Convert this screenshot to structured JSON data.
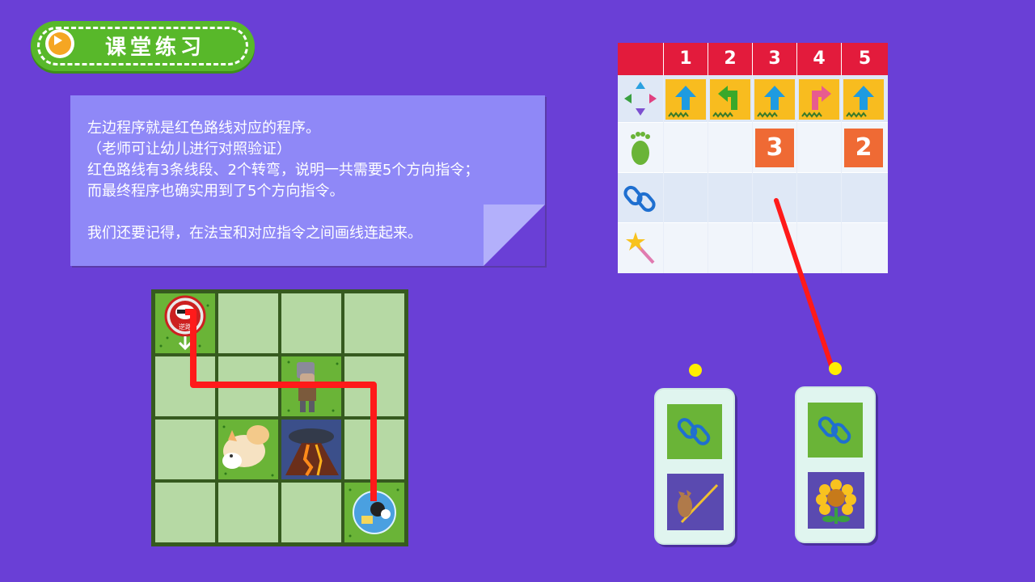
{
  "title": {
    "text": "课堂练习"
  },
  "note": {
    "lines": [
      "左边程序就是红色路线对应的程序。",
      "（老师可让幼儿进行对照验证）",
      "红色路线有3条线段、2个转弯，说明一共需要5个方向指令；",
      "而最终程序也确实用到了5个方向指令。",
      "",
      "我们还要记得，在法宝和对应指令之间画线连起来。"
    ]
  },
  "board": {
    "start_label": "逆路",
    "start_arrow": "down"
  },
  "table": {
    "columns": [
      "1",
      "2",
      "3",
      "4",
      "5"
    ],
    "row_icons": [
      "direction-arrows-icon",
      "footprint-icon",
      "chain-link-icon",
      "magic-wand-icon"
    ],
    "directions": [
      "up",
      "left-turn",
      "up",
      "right-turn",
      "up"
    ],
    "steps": [
      "",
      "",
      "3",
      "",
      "2"
    ],
    "colors": {
      "header": "#e31b3c",
      "tile": "#f8bc1f",
      "badge": "#ef6a34"
    }
  },
  "cards": [
    {
      "top_icon": "chain-link-icon",
      "bottom_icon": "donkey-staff-icon"
    },
    {
      "top_icon": "chain-link-icon",
      "bottom_icon": "sunflower-icon"
    }
  ],
  "route_color": "#ff1a1a"
}
